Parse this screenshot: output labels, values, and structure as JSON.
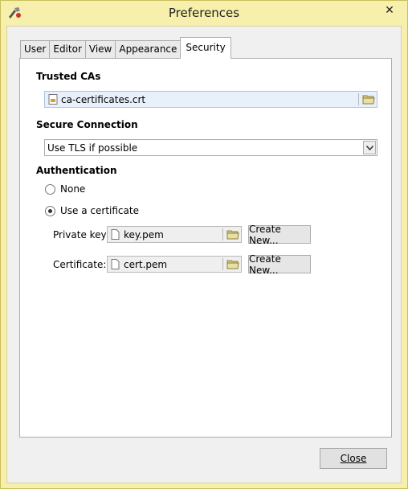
{
  "window": {
    "title": "Preferences",
    "close_glyph": "✕"
  },
  "tabs": [
    {
      "label": "User"
    },
    {
      "label": "Editor"
    },
    {
      "label": "View"
    },
    {
      "label": "Appearance"
    },
    {
      "label": "Security",
      "active": true
    }
  ],
  "trusted_cas": {
    "heading": "Trusted CAs",
    "file": "ca-certificates.crt"
  },
  "secure_connection": {
    "heading": "Secure Connection",
    "selected": "Use TLS if possible"
  },
  "authentication": {
    "heading": "Authentication",
    "options": [
      {
        "label": "None",
        "checked": false
      },
      {
        "label": "Use a certificate",
        "checked": true
      }
    ],
    "private_key": {
      "label": "Private key:",
      "file": "key.pem",
      "create_label": "Create New..."
    },
    "certificate": {
      "label": "Certificate:",
      "file": "cert.pem",
      "create_label": "Create New..."
    }
  },
  "footer": {
    "close_label": "Close"
  },
  "colors": {
    "frame": "#f7f0ac",
    "client": "#f0f0f0",
    "field_highlight": "#e8f1fb",
    "folder": "#d8cc8a"
  },
  "icons": {
    "app": "app-tool-icon",
    "file": "file-icon",
    "certificate_file": "certificate-file-icon",
    "folder": "folder-icon",
    "dropdown": "chevron-down-icon"
  }
}
